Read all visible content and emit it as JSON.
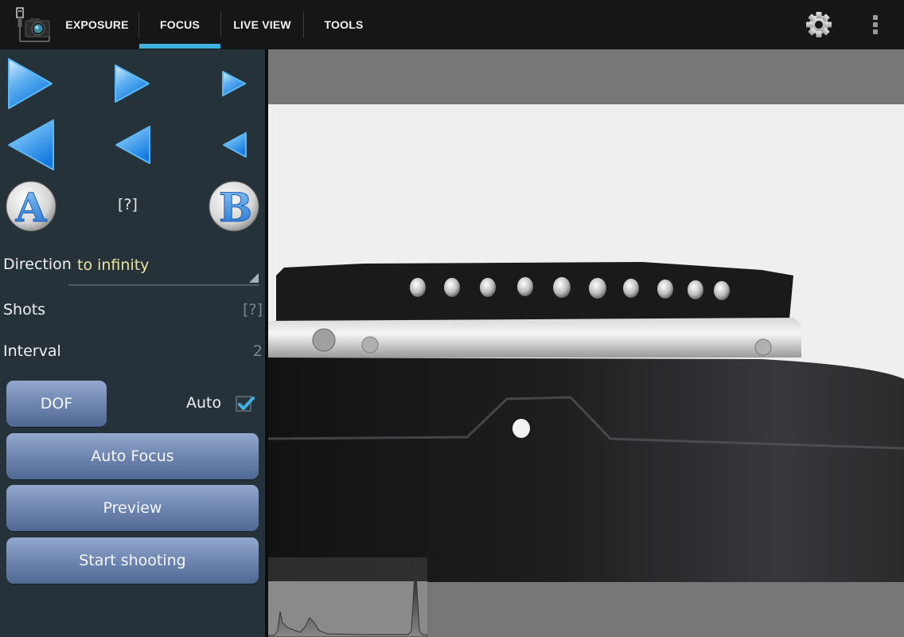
{
  "app": {
    "logo_icon": "usb-camera-icon"
  },
  "tabs": [
    {
      "label": "EXPOSURE",
      "selected": false
    },
    {
      "label": "FOCUS",
      "selected": true
    },
    {
      "label": "LIVE VIEW",
      "selected": false
    },
    {
      "label": "TOOLS",
      "selected": false
    }
  ],
  "toolbar": {
    "settings_icon": "gear-icon",
    "overflow_icon": "more-vert-icon"
  },
  "colors": {
    "accent": "#3fb1e0",
    "panel_bg": "#26323a",
    "topbar_bg": "#161616",
    "selected_value": "#f0e2a0",
    "button_top": "#93a8cc",
    "button_bottom": "#4f6893"
  },
  "focus_panel": {
    "step_buttons": {
      "forward": [
        "focus-far-large",
        "focus-far-medium",
        "focus-far-small"
      ],
      "backward": [
        "focus-near-large",
        "focus-near-medium",
        "focus-near-small"
      ]
    },
    "point_a_label": "A",
    "point_b_label": "B",
    "ab_status": "[?]",
    "direction": {
      "label": "Direction",
      "value": "to infinity"
    },
    "shots": {
      "label": "Shots",
      "value": "[?]"
    },
    "interval": {
      "label": "Interval",
      "value": "2"
    },
    "dof_button": "DOF",
    "auto": {
      "label": "Auto",
      "checked": true
    },
    "auto_focus_button": "Auto Focus",
    "preview_button": "Preview",
    "start_button": "Start shooting"
  },
  "live_view": {
    "subject": "lens mount contacts close-up",
    "histogram_visible": true
  }
}
